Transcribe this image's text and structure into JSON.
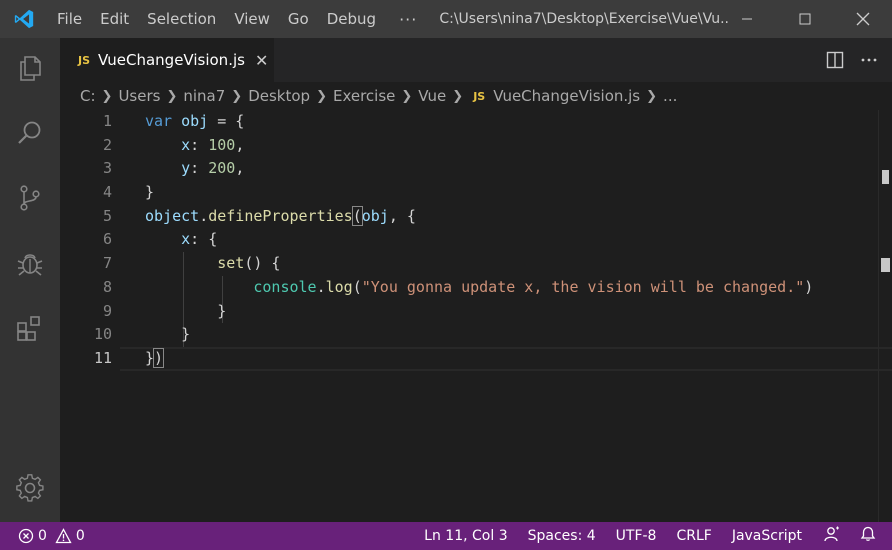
{
  "menu": {
    "items": [
      "File",
      "Edit",
      "Selection",
      "View",
      "Go",
      "Debug"
    ],
    "more": "···"
  },
  "window": {
    "title": "C:\\Users\\nina7\\Desktop\\Exercise\\Vue\\Vu..."
  },
  "tab": {
    "badge": "JS",
    "label": "VueChangeVision.js",
    "close": "✕"
  },
  "breadcrumb": {
    "parts": [
      "C:",
      "Users",
      "nina7",
      "Desktop",
      "Exercise",
      "Vue"
    ],
    "file_badge": "JS",
    "file": "VueChangeVision.js",
    "ellipsis": "..."
  },
  "editor": {
    "line_numbers": [
      "1",
      "2",
      "3",
      "4",
      "5",
      "6",
      "7",
      "8",
      "9",
      "10",
      "11"
    ],
    "code": {
      "l1_kw": "var",
      "l1_var": "obj",
      "l1_rest": " = {",
      "l2_key": "x",
      "l2_colon": ": ",
      "l2_num": "100",
      "l2_rest": ",",
      "l3_key": "y",
      "l3_colon": ": ",
      "l3_num": "200",
      "l3_rest": ",",
      "l4": "}",
      "l5_obj": "object",
      "l5_dot": ".",
      "l5_fn": "defineProperties",
      "l5_paren": "(",
      "l5_var": "obj",
      "l5_rest": ", {",
      "l6_key": "x",
      "l6_rest": ": {",
      "l7_fn": "set",
      "l7_rest": "() {",
      "l8_cls": "console",
      "l8_dot": ".",
      "l8_fn": "log",
      "l8_open": "(",
      "l8_str": "\"You gonna update x, the vision will be changed.\"",
      "l8_close": ")",
      "l9": "}",
      "l10": "}",
      "l11_brace": "}",
      "l11_paren": ")"
    }
  },
  "status": {
    "errors": "0",
    "warnings": "0",
    "position": "Ln 11, Col 3",
    "spaces": "Spaces: 4",
    "encoding": "UTF-8",
    "eol": "CRLF",
    "language": "JavaScript"
  },
  "colors": {
    "status_bar": "#68217a",
    "title_bar": "#3c3c3c",
    "activity_bar": "#333333",
    "editor_bg": "#1e1e1e",
    "accent_blue": "#23a9f2"
  },
  "icons": {
    "logo": "vscode-logo-icon",
    "activity": [
      "files-icon",
      "search-icon",
      "source-control-icon",
      "debug-icon",
      "extensions-icon",
      "gear-icon"
    ]
  }
}
